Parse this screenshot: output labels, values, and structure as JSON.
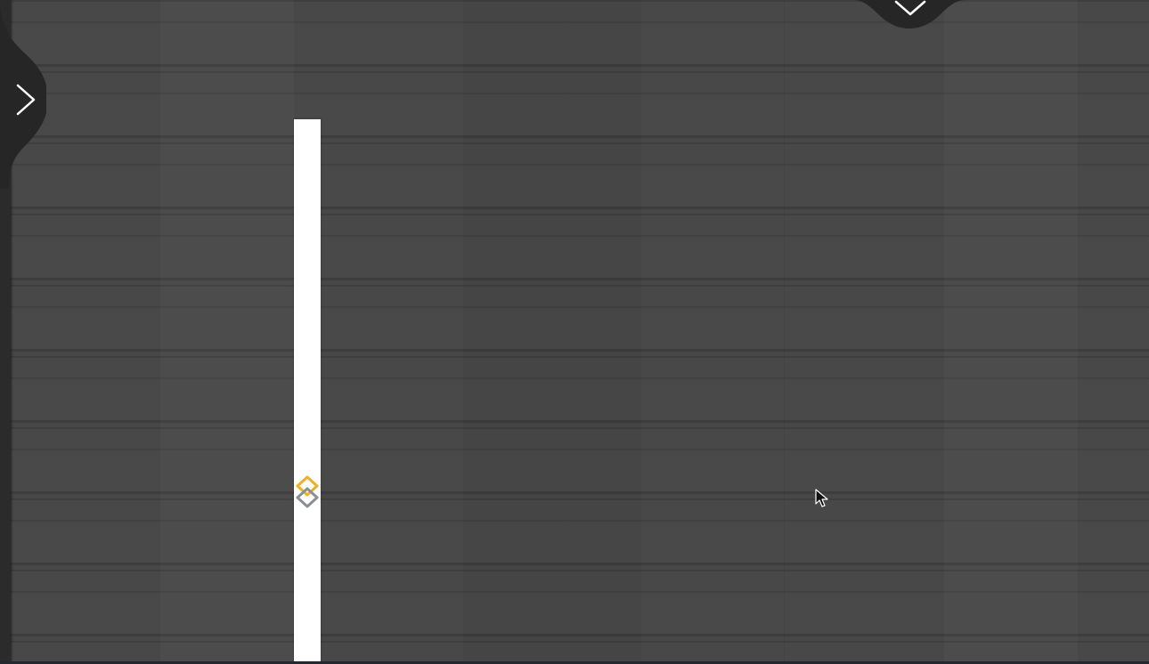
{
  "app": {
    "background": "dark-wood-texture",
    "colors": {
      "background": "#454545",
      "panel_edge": "#2b2b2b",
      "track": "#ffffff",
      "handle_primary": "#f2b01e",
      "handle_secondary": "#8a8f96",
      "toggle_fill": "#262626",
      "toggle_arrow": "#ffffff"
    }
  },
  "side_panel_toggle": {
    "icon": "chevron-right-icon"
  },
  "top_panel_toggle": {
    "icon": "chevron-down-icon"
  },
  "vertical_slider": {
    "handle_icon": "stacked-diamonds-icon"
  },
  "cursor": {
    "icon": "arrow-cursor-icon"
  }
}
